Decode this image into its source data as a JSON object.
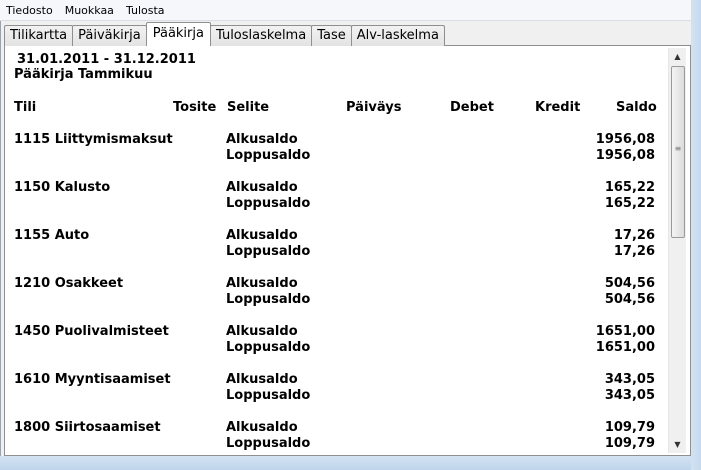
{
  "menu": {
    "items": [
      "Tiedosto",
      "Muokkaa",
      "Tulosta"
    ]
  },
  "tabs": [
    {
      "label": "Tilikartta",
      "active": false
    },
    {
      "label": "Päiväkirja",
      "active": false
    },
    {
      "label": "Pääkirja",
      "active": true
    },
    {
      "label": "Tuloslaskelma",
      "active": false
    },
    {
      "label": "Tase",
      "active": false
    },
    {
      "label": "Alv-laskelma",
      "active": false
    }
  ],
  "report": {
    "date_range": "31.01.2011 - 31.12.2011",
    "title": "Pääkirja Tammikuu",
    "columns": {
      "tili": "Tili",
      "tosite": "Tosite",
      "selite": "Selite",
      "paivays": "Päiväys",
      "debet": "Debet",
      "kredit": "Kredit",
      "saldo": "Saldo"
    },
    "accounts": [
      {
        "name": "1115 Liittymismaksut",
        "start_label": "Alkusaldo",
        "end_label": "Loppusaldo",
        "start_value": "1956,08",
        "end_value": "1956,08"
      },
      {
        "name": "1150 Kalusto",
        "start_label": "Alkusaldo",
        "end_label": "Loppusaldo",
        "start_value": "165,22",
        "end_value": "165,22"
      },
      {
        "name": "1155 Auto",
        "start_label": "Alkusaldo",
        "end_label": "Loppusaldo",
        "start_value": "17,26",
        "end_value": "17,26"
      },
      {
        "name": "1210 Osakkeet",
        "start_label": "Alkusaldo",
        "end_label": "Loppusaldo",
        "start_value": "504,56",
        "end_value": "504,56"
      },
      {
        "name": "1450 Puolivalmisteet",
        "start_label": "Alkusaldo",
        "end_label": "Loppusaldo",
        "start_value": "1651,00",
        "end_value": "1651,00"
      },
      {
        "name": "1610 Myyntisaamiset",
        "start_label": "Alkusaldo",
        "end_label": "Loppusaldo",
        "start_value": "343,05",
        "end_value": "343,05"
      },
      {
        "name": "1800 Siirtosaamiset",
        "start_label": "Alkusaldo",
        "end_label": "Loppusaldo",
        "start_value": "109,79",
        "end_value": "109,79"
      }
    ]
  },
  "scrollbar": {
    "up_icon": "triangle-up",
    "down_icon": "triangle-down",
    "grip_icon": "grip-lines"
  }
}
